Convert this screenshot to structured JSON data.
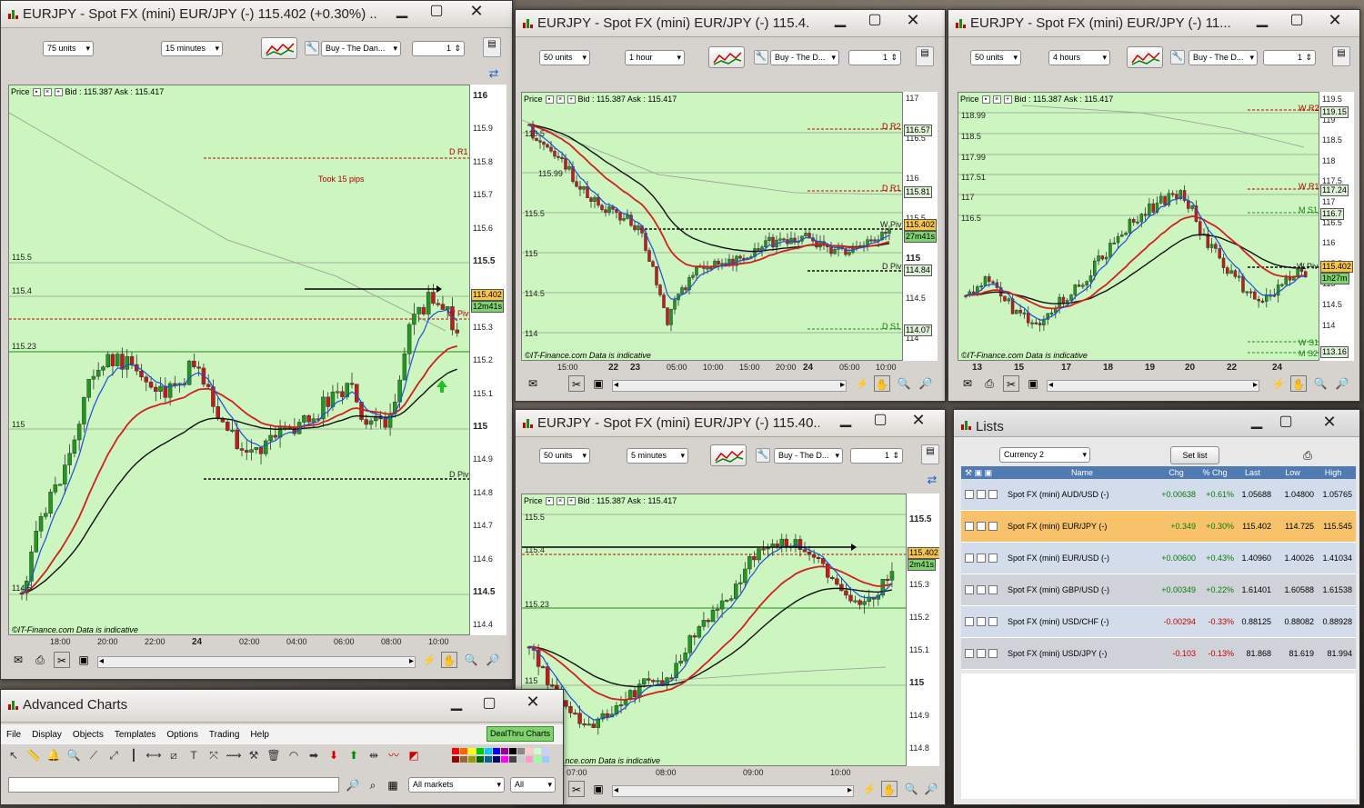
{
  "chart1": {
    "title": "EURJPY - Spot FX (mini) EUR/JPY (-)    115.402 (+0.30%)  ...",
    "units": "75 units",
    "interval": "15 minutes",
    "order": "Buy - The Dan...",
    "qty": "1",
    "header": "Bid : 115.387 Ask : 115.417",
    "price_label": "Price",
    "y_ticks": [
      "116",
      "115.9",
      "115.8",
      "115.7",
      "115.6",
      "115.5",
      "115.4",
      "115.3",
      "115.2",
      "115.1",
      "115",
      "114.9",
      "114.8",
      "114.7",
      "114.6",
      "114.5",
      "114.4"
    ],
    "x_ticks": [
      "18:00",
      "20:00",
      "22:00",
      "24",
      "02:00",
      "04:00",
      "06:00",
      "08:00",
      "10:00"
    ],
    "levels": [
      "115.5",
      "115.4",
      "115.23",
      "115",
      "114.5"
    ],
    "annotations": {
      "dr1": "D R1",
      "took": "Took 15 pips",
      "wpiv": "W Piv",
      "dpiv": "D Piv"
    },
    "price_box": "115.402",
    "timer": "12m41s",
    "footer": "©IT-Finance.com  Data is indicative"
  },
  "chart2": {
    "title": "EURJPY - Spot FX (mini) EUR/JPY (-)    115.4...",
    "units": "50 units",
    "interval": "1 hour",
    "order": "Buy - The D...",
    "qty": "1",
    "header": "Bid : 115.387 Ask : 115.417",
    "price_label": "Price",
    "y_ticks": [
      "117",
      "116.5",
      "116",
      "115.5",
      "115",
      "114.5",
      "114"
    ],
    "x_ticks": [
      "15:00",
      "22",
      "23",
      "05:00",
      "10:00",
      "15:00",
      "20:00",
      "24",
      "05:00",
      "10:00"
    ],
    "levels": [
      "116.5",
      "115.99",
      "115.5",
      "115",
      "114.5",
      "114"
    ],
    "annotations": {
      "dr2": "D R2",
      "dr1": "D R1",
      "wpiv": "W Piv",
      "dpiv": "D Piv",
      "ds1": "D S1"
    },
    "boxes": {
      "dr2": "116.57",
      "dr1": "115.81",
      "price": "115.402",
      "timer": "27m41s",
      "dpiv": "114.84",
      "ds1": "114.07"
    },
    "footer": "©IT-Finance.com  Data is indicative"
  },
  "chart3": {
    "title": "EURJPY - Spot FX (mini) EUR/JPY (-)    11...",
    "units": "50 units",
    "interval": "4 hours",
    "order": "Buy - The D...",
    "qty": "1",
    "header": "Bid : 115.387 Ask : 115.417",
    "price_label": "Price",
    "y_ticks": [
      "119.5",
      "119",
      "118.5",
      "118",
      "117.5",
      "117",
      "116.5",
      "116",
      "115.5",
      "115",
      "114.5",
      "114"
    ],
    "x_ticks": [
      "13",
      "15",
      "17",
      "18",
      "19",
      "20",
      "22",
      "24"
    ],
    "levels": [
      "118.99",
      "118.5",
      "117.99",
      "117.51",
      "117",
      "116.5"
    ],
    "annotations": {
      "wr2": "W R2",
      "wr1": "W R1",
      "ms1": "M S1",
      "wpiv": "W Piv",
      "ws1": "W S1",
      "ms2": "M S2"
    },
    "boxes": {
      "wr2": "119.15",
      "wr1": "117.24",
      "ms1": "116.7",
      "price": "115.402",
      "timer": "1h27m",
      "ms2": "113.16"
    },
    "footer": "©IT-Finance.com  Data is indicative"
  },
  "chart4": {
    "title": "EURJPY - Spot FX (mini) EUR/JPY (-)    115.40...",
    "units": "50 units",
    "interval": "5 minutes",
    "order": "Buy - The D...",
    "qty": "1",
    "header": "Bid : 115.387 Ask : 115.417",
    "price_label": "Price",
    "y_ticks": [
      "115.5",
      "115.4",
      "115.3",
      "115.2",
      "115.1",
      "115",
      "114.9",
      "114.8"
    ],
    "x_ticks": [
      "07:00",
      "08:00",
      "09:00",
      "10:00"
    ],
    "levels": [
      "115.5",
      "115.4",
      "115.23",
      "115"
    ],
    "price_box": "115.402",
    "timer": "2m41s",
    "footer": "...nce.com  Data is indicative"
  },
  "lists": {
    "title": "Lists",
    "filter": "Currency 2",
    "setlist": "Set list",
    "columns": [
      "Name",
      "Chg",
      "% Chg",
      "Last",
      "Low",
      "High"
    ],
    "rows": [
      {
        "name": "Spot FX (mini) AUD/USD (-)",
        "chg": "+0.00638",
        "pct": "+0.61%",
        "last": "1.05688",
        "low": "1.04800",
        "high": "1.05765",
        "dir": "pos",
        "bg": "#d3dcea"
      },
      {
        "name": "Spot FX (mini) EUR/JPY (-)",
        "chg": "+0.349",
        "pct": "+0.30%",
        "last": "115.402",
        "low": "114.725",
        "high": "115.545",
        "dir": "pos",
        "bg": "#f8c26a"
      },
      {
        "name": "Spot FX (mini) EUR/USD (-)",
        "chg": "+0.00600",
        "pct": "+0.43%",
        "last": "1.40960",
        "low": "1.40026",
        "high": "1.41034",
        "dir": "pos",
        "bg": "#d3dcea"
      },
      {
        "name": "Spot FX (mini) GBP/USD (-)",
        "chg": "+0.00349",
        "pct": "+0.22%",
        "last": "1.61401",
        "low": "1.60588",
        "high": "1.61538",
        "dir": "pos",
        "bg": "#cfd3d9"
      },
      {
        "name": "Spot FX (mini) USD/CHF (-)",
        "chg": "-0.00294",
        "pct": "-0.33%",
        "last": "0.88125",
        "low": "0.88082",
        "high": "0.88928",
        "dir": "neg",
        "bg": "#d3dcea"
      },
      {
        "name": "Spot FX (mini) USD/JPY (-)",
        "chg": "-0.103",
        "pct": "-0.13%",
        "last": "81.868",
        "low": "81.619",
        "high": "81.994",
        "dir": "neg",
        "bg": "#cfd3d9"
      }
    ]
  },
  "advanced": {
    "title": "Advanced Charts",
    "menu": [
      "File",
      "Display",
      "Objects",
      "Templates",
      "Options",
      "Trading",
      "Help"
    ],
    "dealthru": "DealThru Charts",
    "market": "All markets",
    "filter": "All"
  },
  "colors": {
    "plot_bg": "#ccf5bf",
    "bull": "#1f9a1f",
    "bear": "#c61a1a",
    "ema_red": "#d21f1f",
    "ema_blue": "#1d4fd8",
    "ema_black": "#111111",
    "pivot": "#111111",
    "accent_box": "#f7c44a"
  }
}
